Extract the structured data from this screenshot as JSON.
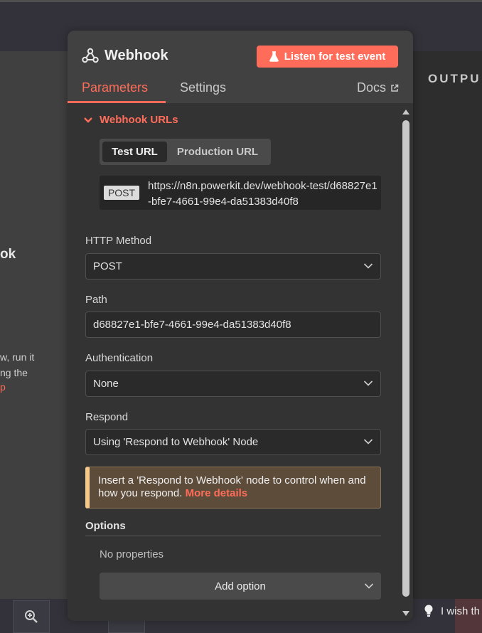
{
  "background": {
    "left_title": "ok",
    "left_text_1": "w, run it",
    "left_text_2": "ng the",
    "left_link": "p",
    "output_label": "OUTPU",
    "hint_text": "I wish th"
  },
  "modal": {
    "title": "Webhook",
    "listen_button": "Listen for test event",
    "tabs": [
      {
        "label": "Parameters",
        "active": true
      },
      {
        "label": "Settings",
        "active": false
      }
    ],
    "docs_label": "Docs",
    "webhook_urls": {
      "section_label": "Webhook URLs",
      "switch": {
        "test": "Test URL",
        "production": "Production URL",
        "selected": "Test URL"
      },
      "method_tag": "POST",
      "url": "https://n8n.powerkit.dev/webhook-test/d68827e1-bfe7-4661-99e4-da51383d40f8"
    },
    "fields": {
      "http_method": {
        "label": "HTTP Method",
        "value": "POST"
      },
      "path": {
        "label": "Path",
        "value": "d68827e1-bfe7-4661-99e4-da51383d40f8"
      },
      "authentication": {
        "label": "Authentication",
        "value": "None"
      },
      "respond": {
        "label": "Respond",
        "value": "Using 'Respond to Webhook' Node"
      }
    },
    "notice": {
      "text": "Insert a 'Respond to Webhook' node to control when and how you respond.",
      "link": "More details"
    },
    "options": {
      "title": "Options",
      "empty_text": "No properties",
      "add_button": "Add option"
    }
  },
  "colors": {
    "accent": "#ff6d5a",
    "notice_bg": "#5e4c3a",
    "notice_border": "#f5c98c"
  }
}
